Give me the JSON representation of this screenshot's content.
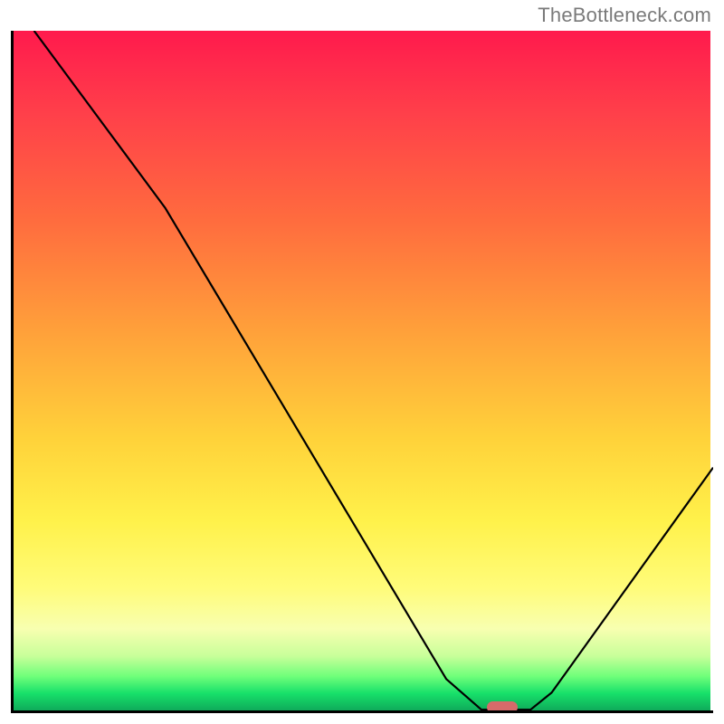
{
  "watermark": "TheBottleneck.com",
  "chart_data": {
    "type": "line",
    "title": "",
    "xlabel": "",
    "ylabel": "",
    "xlim": [
      0,
      100
    ],
    "ylim": [
      0,
      100
    ],
    "grid": false,
    "curve_points": [
      {
        "x": 3.3,
        "y": 100.0
      },
      {
        "x": 22.0,
        "y": 74.0
      },
      {
        "x": 62.0,
        "y": 5.0
      },
      {
        "x": 67.0,
        "y": 0.5
      },
      {
        "x": 74.0,
        "y": 0.5
      },
      {
        "x": 77.0,
        "y": 3.0
      },
      {
        "x": 100.0,
        "y": 36.0
      }
    ],
    "marker": {
      "x": 70.0,
      "y": 0.5,
      "color": "#d66a6a"
    },
    "background_type": "vertical_gradient",
    "gradient_stops": [
      {
        "pos": 0.0,
        "color": "#ff1a4d"
      },
      {
        "pos": 0.12,
        "color": "#ff3f4a"
      },
      {
        "pos": 0.28,
        "color": "#ff6c3e"
      },
      {
        "pos": 0.45,
        "color": "#ffa33a"
      },
      {
        "pos": 0.6,
        "color": "#ffd23a"
      },
      {
        "pos": 0.72,
        "color": "#fff14a"
      },
      {
        "pos": 0.82,
        "color": "#fffc7a"
      },
      {
        "pos": 0.88,
        "color": "#f8ffb0"
      },
      {
        "pos": 0.92,
        "color": "#c8ff9a"
      },
      {
        "pos": 0.95,
        "color": "#6fff7a"
      },
      {
        "pos": 0.975,
        "color": "#17e06a"
      },
      {
        "pos": 1.0,
        "color": "#0fab5a"
      }
    ]
  }
}
